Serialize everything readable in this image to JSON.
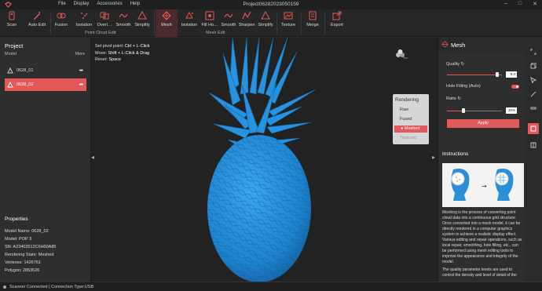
{
  "window": {
    "title": "Project06282023050159",
    "menu": [
      "File",
      "Display",
      "Accessories",
      "Help"
    ],
    "controls": [
      "–",
      "□",
      "✕"
    ]
  },
  "toolbar": {
    "tools": [
      {
        "label": "Scan",
        "icon": "scanner-icon",
        "group": ""
      },
      {
        "label": "Auto Edit",
        "icon": "auto-edit-icon",
        "group": ""
      },
      {
        "label": "Fusion",
        "icon": "fusion-icon",
        "group": "point_cloud"
      },
      {
        "label": "Isolation",
        "icon": "isolation-icon",
        "group": "point_cloud"
      },
      {
        "label": "Overl…",
        "icon": "overlap-icon",
        "group": "point_cloud"
      },
      {
        "label": "Smooth",
        "icon": "smooth-icon",
        "group": "point_cloud"
      },
      {
        "label": "Simplify",
        "icon": "simplify-icon",
        "group": "point_cloud"
      },
      {
        "label": "Mesh",
        "icon": "mesh-icon",
        "group": "mesh"
      },
      {
        "label": "Isolation",
        "icon": "isolation-icon",
        "group": "mesh"
      },
      {
        "label": "Fill Ho…",
        "icon": "fill-hole-icon",
        "group": "mesh"
      },
      {
        "label": "Smooth",
        "icon": "smooth-icon",
        "group": "mesh"
      },
      {
        "label": "Sharpen",
        "icon": "sharpen-icon",
        "group": "mesh"
      },
      {
        "label": "Simplify",
        "icon": "simplify-icon",
        "group": "mesh"
      },
      {
        "label": "Texture",
        "icon": "texture-icon",
        "group": ""
      },
      {
        "label": "Merge",
        "icon": "merge-icon",
        "group": ""
      },
      {
        "label": "Export",
        "icon": "export-icon",
        "group": ""
      }
    ],
    "groups": {
      "point_cloud": "Point Cloud Edit",
      "mesh": "Mesh Edit"
    }
  },
  "project": {
    "title": "Project",
    "model_header": "Model",
    "more": "More",
    "models": [
      {
        "name": "0628_01",
        "selected": false
      },
      {
        "name": "0628_02",
        "selected": true
      }
    ]
  },
  "properties": {
    "title": "Properties",
    "rows": [
      {
        "label": "Model Name:",
        "value": "0628_02"
      },
      {
        "label": "Model:",
        "value": "POP 3"
      },
      {
        "label": "SN:",
        "value": "A23403512C6H00A85"
      },
      {
        "label": "Rendering State:",
        "value": "Meshed"
      },
      {
        "label": "Vertexes:",
        "value": "1426761"
      },
      {
        "label": "Polygon:",
        "value": "2853526"
      }
    ]
  },
  "viewport": {
    "help": [
      {
        "label": "Set pivot point:",
        "keys": "Ctrl + L-Click"
      },
      {
        "label": "Move:",
        "keys": "Shift + L-Click & Drag"
      },
      {
        "label": "Reset:",
        "keys": "Space"
      }
    ],
    "rendering": {
      "title": "Rendering",
      "options": [
        "Raw",
        "Fused",
        "Meshed",
        "Textured"
      ],
      "selected": "Meshed",
      "disabled": [
        "Textured"
      ]
    }
  },
  "mesh_panel": {
    "title": "Mesh",
    "quality_label": "Quality",
    "quality_value": "6.0",
    "quality_fraction": 0.92,
    "hole_filling_label": "Hole Filling (Auto)",
    "hole_filling_on": true,
    "ratio_label": "Ratio",
    "ratio_value": "30%",
    "ratio_fraction": 0.3,
    "apply_label": "Apply",
    "instructions_title": "Instructions",
    "instructions_p1": "Meshing is the process of converting point cloud data into a continuous grid structure. Once converted into a mesh model, it can be directly rendered in a computer graphics system to achieve a realistic display effect. Various editing and repair operations, such as local repair, smoothing, hole filling, etc., can be performed using mesh editing tools to improve the appearance and integrity of the model.",
    "instructions_p2": "The quality parameter levels are used to control the density and level of detail of the"
  },
  "colors": {
    "accent": "#e35858",
    "model": "#2a8fd8"
  },
  "statusbar": {
    "text": "Scanner Connected | Connection Type:USB"
  }
}
